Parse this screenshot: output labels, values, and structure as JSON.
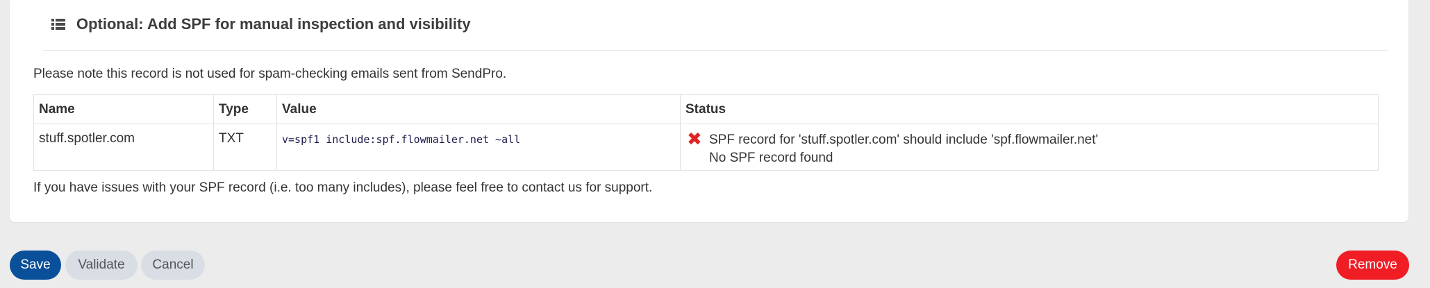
{
  "panel": {
    "title": "Optional: Add SPF for manual inspection and visibility",
    "icon": "list-icon",
    "note": "Please note this record is not used for spam-checking emails sent from SendPro.",
    "support_text": "If you have issues with your SPF record (i.e. too many includes), please feel free to contact us for support."
  },
  "table": {
    "headers": [
      "Name",
      "Type",
      "Value",
      "Status"
    ],
    "rows": [
      {
        "name": "stuff.spotler.com",
        "type": "TXT",
        "value": "v=spf1 include:spf.flowmailer.net ~all",
        "status_icon": "error-x-icon",
        "status_lines": [
          "SPF record for 'stuff.spotler.com' should include 'spf.flowmailer.net'",
          "No SPF record found"
        ]
      }
    ]
  },
  "actions": {
    "save": "Save",
    "validate": "Validate",
    "cancel": "Cancel",
    "remove": "Remove"
  },
  "colors": {
    "primary": "#0a4f99",
    "danger": "#f01d25",
    "error_icon": "#e02424",
    "secondary": "#d9dde4"
  }
}
